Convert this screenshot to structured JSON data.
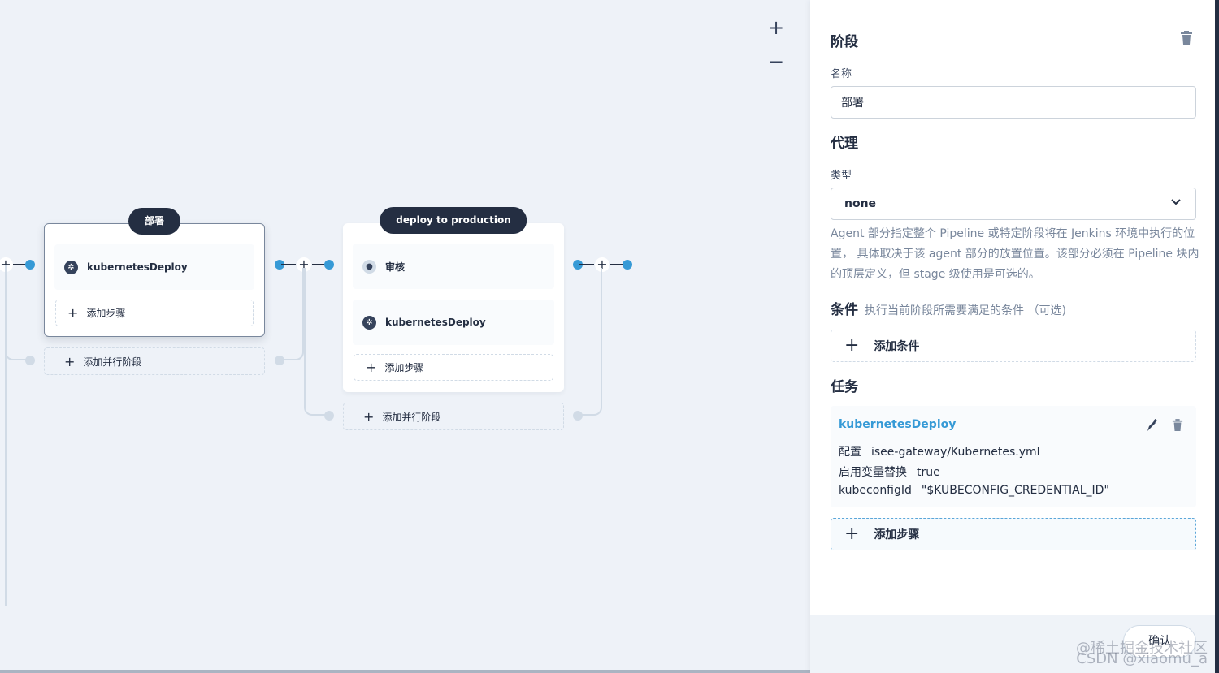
{
  "canvas": {
    "zoom_in": "+",
    "zoom_out": "−",
    "plus": "+",
    "stages": [
      {
        "title": "部署",
        "steps": [
          {
            "label": "kubernetesDeploy",
            "icon": "kubernetes-icon"
          }
        ],
        "add_step": "添加步骤",
        "add_parallel": "添加并行阶段"
      },
      {
        "title": "deploy to production",
        "steps": [
          {
            "label": "审核",
            "icon": "review-icon"
          },
          {
            "label": "kubernetesDeploy",
            "icon": "kubernetes-icon"
          }
        ],
        "add_step": "添加步骤",
        "add_parallel": "添加并行阶段"
      }
    ]
  },
  "panel": {
    "title": "阶段",
    "name_label": "名称",
    "name_value": "部署",
    "agent_title": "代理",
    "type_label": "类型",
    "type_value": "none",
    "agent_desc": "Agent 部分指定整个 Pipeline 或特定阶段将在 Jenkins 环境中执行的位置， 具体取决于该 agent 部分的放置位置。该部分必须在 Pipeline 块内的顶层定义，但 stage 级使用是可选的。",
    "condition_title": "条件",
    "condition_sub": "执行当前阶段所需要满足的条件 （可选)",
    "add_condition": "添加条件",
    "task_title": "任务",
    "task": {
      "name": "kubernetesDeploy",
      "rows": [
        {
          "key": "配置",
          "value": "isee-gateway/Kubernetes.yml"
        },
        {
          "key": "启用变量替换",
          "value": "true"
        },
        {
          "key": "kubeconfigId",
          "value": "\"$KUBECONFIG_CREDENTIAL_ID\""
        }
      ]
    },
    "add_step": "添加步骤",
    "confirm": "确认"
  },
  "watermark": {
    "line1": "@稀土掘金技术社区",
    "line2": "CSDN @xiaomu_a"
  },
  "colors": {
    "accent": "#369ad6",
    "dark": "#242e42",
    "canvas_bg": "#eef2f8"
  }
}
